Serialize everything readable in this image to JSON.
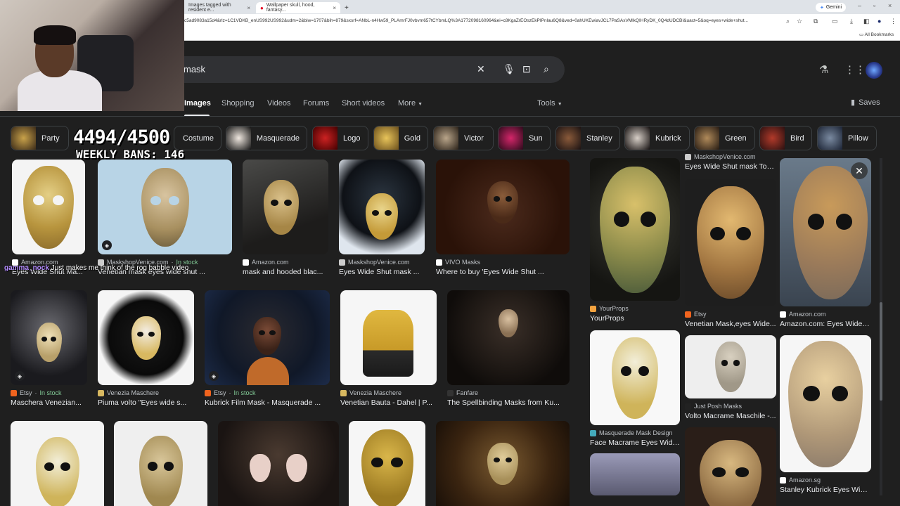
{
  "browser": {
    "tabs": [
      {
        "label": "Images tagged with resident e...",
        "active": false
      },
      {
        "label": "Wallpaper skull, hood, fantasy...",
        "active": true
      }
    ],
    "gemini_label": "Gemini",
    "url": "c5ad9083a15d4&rlz=1C1VDKB_enUS992US992&udm=2&biw=1707&bih=879&sxsrf=ANbL-n4Hw59_PLAmrFJ0vbvm657tCYbmLQ%3A1772098160964&ei=c8KgaZrEOszEkPIPnlau6Q8&ved=0ahUKEwiavJCL7PaSAxVMlkQIHRyDK_0Q4dUDCBI&uact=5&oq=eyes+wide+shut...",
    "all_bookmarks": "All Bookmarks"
  },
  "search": {
    "query": "mask"
  },
  "nav": {
    "tabs": [
      "Images",
      "Shopping",
      "Videos",
      "Forums",
      "Short videos",
      "More"
    ],
    "tools": "Tools",
    "saves": "Saves"
  },
  "chips": [
    "Party",
    "Costume",
    "Masquerade",
    "Logo",
    "Gold",
    "Victor",
    "Sun",
    "Stanley",
    "Kubrick",
    "Green",
    "Bird",
    "Pillow"
  ],
  "overlay": {
    "counter": "4494/4500",
    "bans": "WEEKLY BANS: 146",
    "chat_user": "gamma_nock",
    "chat_msg": "Just makes me think of the rog babble video"
  },
  "results": [
    {
      "source": "Amazon.com",
      "title": "Eyes Wide Shut Ma...",
      "stock": ""
    },
    {
      "source": "MaskshopVenice.com",
      "title": "Venetian mask eyes wide shut ...",
      "stock": "In stock"
    },
    {
      "source": "Amazon.com",
      "title": "mask and hooded blac...",
      "stock": ""
    },
    {
      "source": "MaskshopVenice.com",
      "title": "Eyes Wide Shut mask ...",
      "stock": ""
    },
    {
      "source": "VIVO Masks",
      "title": "Where to buy 'Eyes Wide Shut ...",
      "stock": ""
    },
    {
      "source": "Etsy",
      "title": "Maschera Venezian...",
      "stock": "In stock"
    },
    {
      "source": "Venezia Maschere",
      "title": "Piuma volto \"Eyes wide s...",
      "stock": ""
    },
    {
      "source": "Etsy",
      "title": "Kubrick Film Mask - Masquerade ...",
      "stock": "In stock"
    },
    {
      "source": "Venezia Maschere",
      "title": "Venetian Bauta - Dahel | P...",
      "stock": ""
    },
    {
      "source": "Fanfare",
      "title": "The Spellbinding Masks from Ku...",
      "stock": ""
    }
  ],
  "side_results": [
    {
      "source": "MaskshopVenice.com",
      "title": "Eyes Wide Shut mask Tom..."
    },
    {
      "source": "YourProps",
      "title": "YourProps"
    },
    {
      "source": "Etsy",
      "title": "Venetian Mask,eyes Wide..."
    },
    {
      "source": "Amazon.com",
      "title": "Amazon.com: Eyes Wide Sh..."
    },
    {
      "source": "Just Posh Masks",
      "title": "Volto Macrame Maschile -..."
    },
    {
      "source": "Masquerade Mask Design",
      "title": "Face Macrame Eyes Wide..."
    },
    {
      "source": "Amazon.sg",
      "title": "Stanley Kubrick Eyes Wide..."
    }
  ]
}
